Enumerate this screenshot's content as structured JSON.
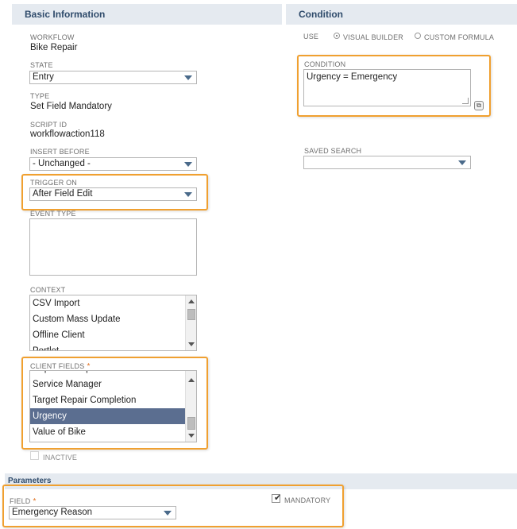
{
  "basic_info": {
    "header": "Basic Information",
    "workflow": {
      "label": "WORKFLOW",
      "value": "Bike Repair"
    },
    "state": {
      "label": "STATE",
      "value": "Entry"
    },
    "type": {
      "label": "TYPE",
      "value": "Set Field Mandatory"
    },
    "script_id": {
      "label": "SCRIPT ID",
      "value": "workflowaction118"
    },
    "insert_before": {
      "label": "INSERT BEFORE",
      "value": "- Unchanged -"
    },
    "trigger_on": {
      "label": "TRIGGER ON",
      "value": "After Field Edit"
    },
    "event_type": {
      "label": "EVENT TYPE",
      "value": ""
    },
    "context": {
      "label": "CONTEXT",
      "items": [
        "CSV Import",
        "Custom Mass Update",
        "Offline Client",
        "Portlet"
      ]
    },
    "client_fields": {
      "label": "CLIENT FIELDS",
      "required_marker": "*",
      "items": [
        "Repairs Complete",
        "Service Manager",
        "Target Repair Completion",
        "Urgency",
        "Value of Bike"
      ],
      "selected": "Urgency"
    },
    "inactive": {
      "label": "INACTIVE",
      "checked": false
    }
  },
  "condition": {
    "header": "Condition",
    "use_label": "USE",
    "visual_builder": "VISUAL BUILDER",
    "custom_formula": "CUSTOM FORMULA",
    "selected_mode": "VISUAL BUILDER",
    "condition_label": "CONDITION",
    "condition_value": "Urgency = Emergency",
    "saved_search_label": "SAVED SEARCH",
    "saved_search_value": ""
  },
  "parameters": {
    "header": "Parameters",
    "field_label": "FIELD",
    "required_marker": "*",
    "field_value": "Emergency Reason",
    "mandatory_label": "MANDATORY",
    "mandatory_checked": true
  },
  "colors": {
    "highlight": "#f0a030",
    "section_header_bg": "#e5eaf0",
    "selected_row_bg": "#5b6e90"
  }
}
